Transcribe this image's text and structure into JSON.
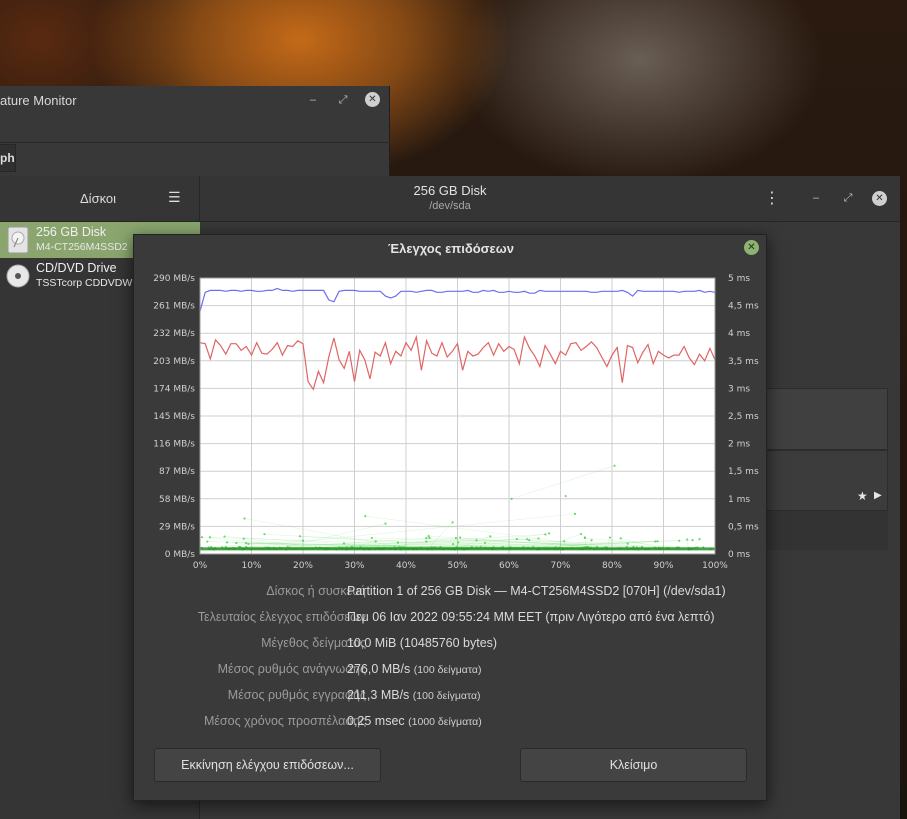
{
  "temp_monitor": {
    "title": "ature Monitor",
    "tab_label": "ph",
    "minimize": "‒",
    "maximize": "⤢",
    "close": "✕"
  },
  "disks": {
    "sidebar_title": "Δίσκοι",
    "menu_icon": "☰",
    "header_title": "256 GB Disk",
    "header_subtitle": "/dev/sda",
    "kebab_icon": "⋮",
    "minimize": "‒",
    "maximize": "⤢",
    "close": "✕",
    "items": [
      {
        "name": "256 GB Disk",
        "model": "M4-CT256M4SSD2",
        "icon": "drive-harddisk-icon",
        "selected": true
      },
      {
        "name": "CD/DVD Drive",
        "model": "TSSTcorp CDDVDW",
        "icon": "optical-drive-icon",
        "selected": false
      }
    ],
    "star_icon": "★",
    "play_icon": "▶"
  },
  "dialog": {
    "title": "Έλεγχος επιδόσεων",
    "close": "✕",
    "info": [
      {
        "label": "Δίσκος ή συσκευή",
        "value": "Partition 1 of 256 GB Disk — M4-CT256M4SSD2 [070H] (/dev/sda1)",
        "note": ""
      },
      {
        "label": "Τελευταίος έλεγχος επιδόσεων",
        "value": "Πεμ 06 Ιαν 2022 09:55:24 MM EET (πριν Λιγότερο από ένα λεπτό)",
        "note": ""
      },
      {
        "label": "Μέγεθος δείγματος",
        "value": "10,0 MiB (10485760 bytes)",
        "note": ""
      },
      {
        "label": "Μέσος ρυθμός ανάγνωσης",
        "value": "276,0 MB/s",
        "note": "(100 δείγματα)"
      },
      {
        "label": "Μέσος ρυθμός εγγραφής",
        "value": "211,3 MB/s",
        "note": "(100 δείγματα)"
      },
      {
        "label": "Μέσος χρόνος προσπέλασης",
        "value": "0,25 msec",
        "note": "(1000 δείγματα)"
      }
    ],
    "start_button": "Εκκίνηση ελέγχου επιδόσεων...",
    "close_button": "Κλείσιμο"
  },
  "chart_data": {
    "type": "line",
    "x": [
      0,
      1,
      2,
      3,
      4,
      5,
      6,
      7,
      8,
      9,
      10,
      11,
      12,
      13,
      14,
      15,
      16,
      17,
      18,
      19,
      20,
      21,
      22,
      23,
      24,
      25,
      26,
      27,
      28,
      29,
      30,
      31,
      32,
      33,
      34,
      35,
      36,
      37,
      38,
      39,
      40,
      41,
      42,
      43,
      44,
      45,
      46,
      47,
      48,
      49,
      50,
      51,
      52,
      53,
      54,
      55,
      56,
      57,
      58,
      59,
      60,
      61,
      62,
      63,
      64,
      65,
      66,
      67,
      68,
      69,
      70,
      71,
      72,
      73,
      74,
      75,
      76,
      77,
      78,
      79,
      80,
      81,
      82,
      83,
      84,
      85,
      86,
      87,
      88,
      89,
      90,
      91,
      92,
      93,
      94,
      95,
      96,
      97,
      98,
      99,
      100
    ],
    "x_ticks": [
      "0%",
      "10%",
      "20%",
      "30%",
      "40%",
      "50%",
      "60%",
      "70%",
      "80%",
      "90%",
      "100%"
    ],
    "y_left_ticks": [
      "0 MB/s",
      "29 MB/s",
      "58 MB/s",
      "87 MB/s",
      "116 MB/s",
      "145 MB/s",
      "174 MB/s",
      "203 MB/s",
      "232 MB/s",
      "261 MB/s",
      "290 MB/s"
    ],
    "y_right_ticks": [
      "0 ms",
      "0,5 ms",
      "1 ms",
      "1,5 ms",
      "2 ms",
      "2,5 ms",
      "3 ms",
      "3,5 ms",
      "4 ms",
      "4,5 ms",
      "5 ms"
    ],
    "ylim_left": [
      0,
      290
    ],
    "ylim_right": [
      0,
      5
    ],
    "grid": true,
    "series": [
      {
        "axis": "left",
        "color": "#6e6ef0",
        "values": [
          255,
          275,
          277,
          277,
          277,
          276,
          277,
          277,
          276,
          277,
          277,
          276,
          276,
          277,
          277,
          279,
          277,
          277,
          276,
          277,
          277,
          277,
          277,
          277,
          277,
          267,
          265,
          276,
          277,
          277,
          277,
          276,
          276,
          276,
          276,
          276,
          271,
          269,
          271,
          276,
          276,
          276,
          275,
          276,
          277,
          277,
          275,
          275,
          276,
          276,
          276,
          276,
          277,
          275,
          275,
          277,
          276,
          277,
          275,
          275,
          276,
          275,
          275,
          276,
          274,
          274,
          277,
          276,
          276,
          276,
          276,
          276,
          276,
          276,
          276,
          276,
          275,
          275,
          276,
          276,
          276,
          276,
          277,
          275,
          271,
          277,
          276,
          276,
          276,
          276,
          276,
          276,
          276,
          275,
          276,
          276,
          276,
          277,
          275,
          276,
          275
        ]
      },
      {
        "axis": "left",
        "color": "#e06464",
        "values": [
          222,
          221,
          205,
          225,
          219,
          210,
          221,
          221,
          214,
          218,
          209,
          222,
          211,
          210,
          215,
          222,
          209,
          219,
          218,
          224,
          221,
          181,
          173,
          192,
          180,
          207,
          227,
          204,
          195,
          213,
          181,
          214,
          204,
          184,
          212,
          208,
          222,
          200,
          213,
          208,
          222,
          214,
          228,
          193,
          224,
          211,
          208,
          222,
          207,
          213,
          221,
          193,
          213,
          208,
          210,
          217,
          222,
          209,
          221,
          213,
          218,
          215,
          200,
          228,
          216,
          208,
          197,
          219,
          210,
          200,
          213,
          209,
          221,
          222,
          214,
          218,
          223,
          217,
          207,
          197,
          209,
          217,
          180,
          219,
          217,
          201,
          212,
          220,
          200,
          213,
          209,
          206,
          209,
          209,
          218,
          206,
          199,
          210,
          203,
          216,
          204
        ]
      }
    ],
    "scatter_series": {
      "axis": "right",
      "color": "#4ed24e",
      "note": "access time samples, mostly 0.1-0.4 ms with a few outliers up to ~1.6 ms"
    }
  }
}
